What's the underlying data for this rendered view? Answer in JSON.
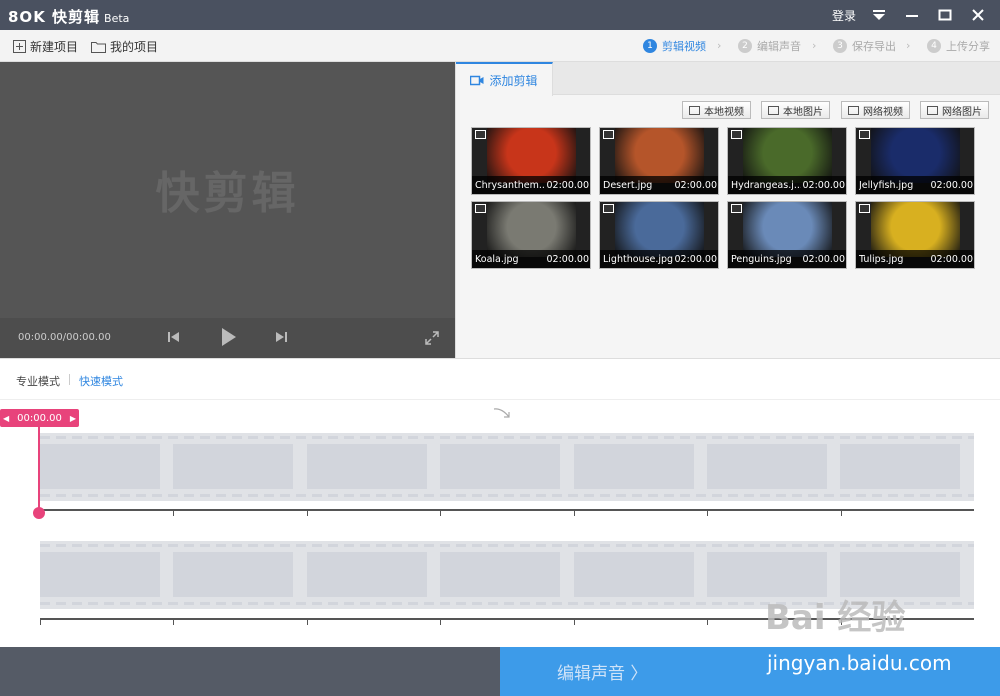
{
  "app": {
    "logo": "8OK 快剪辑",
    "beta": "Beta"
  },
  "titlebar": {
    "login": "登录"
  },
  "toolbar": {
    "new_project": "新建项目",
    "my_projects": "我的项目"
  },
  "steps": [
    {
      "num": "1",
      "label": "剪辑视频",
      "active": true
    },
    {
      "num": "2",
      "label": "编辑声音",
      "active": false
    },
    {
      "num": "3",
      "label": "保存导出",
      "active": false
    },
    {
      "num": "4",
      "label": "上传分享",
      "active": false
    }
  ],
  "preview": {
    "watermark": "快剪辑",
    "timecode": "00:00.00/00:00.00"
  },
  "panel": {
    "tab": "添加剪辑",
    "sources": [
      "本地视频",
      "本地图片",
      "网络视频",
      "网络图片"
    ],
    "thumbnails": [
      {
        "name": "Chrysanthem...",
        "duration": "02:00.00",
        "color": "#c8351a"
      },
      {
        "name": "Desert.jpg",
        "duration": "02:00.00",
        "color": "#b5552a"
      },
      {
        "name": "Hydrangeas.j...",
        "duration": "02:00.00",
        "color": "#4a6a2a"
      },
      {
        "name": "Jellyfish.jpg",
        "duration": "02:00.00",
        "color": "#1a2c6a"
      },
      {
        "name": "Koala.jpg",
        "duration": "02:00.00",
        "color": "#7a7a72"
      },
      {
        "name": "Lighthouse.jpg",
        "duration": "02:00.00",
        "color": "#4a6a9a"
      },
      {
        "name": "Penguins.jpg",
        "duration": "02:00.00",
        "color": "#6a8ab8"
      },
      {
        "name": "Tulips.jpg",
        "duration": "02:00.00",
        "color": "#d8b020"
      }
    ]
  },
  "modes": {
    "pro": "专业模式",
    "quick": "快速模式"
  },
  "timeline": {
    "playhead": "00:00.00"
  },
  "footer": {
    "next": "编辑声音 〉"
  },
  "watermarks": {
    "baidu": "Bai 经验",
    "url": "jingyan.baidu.com"
  }
}
